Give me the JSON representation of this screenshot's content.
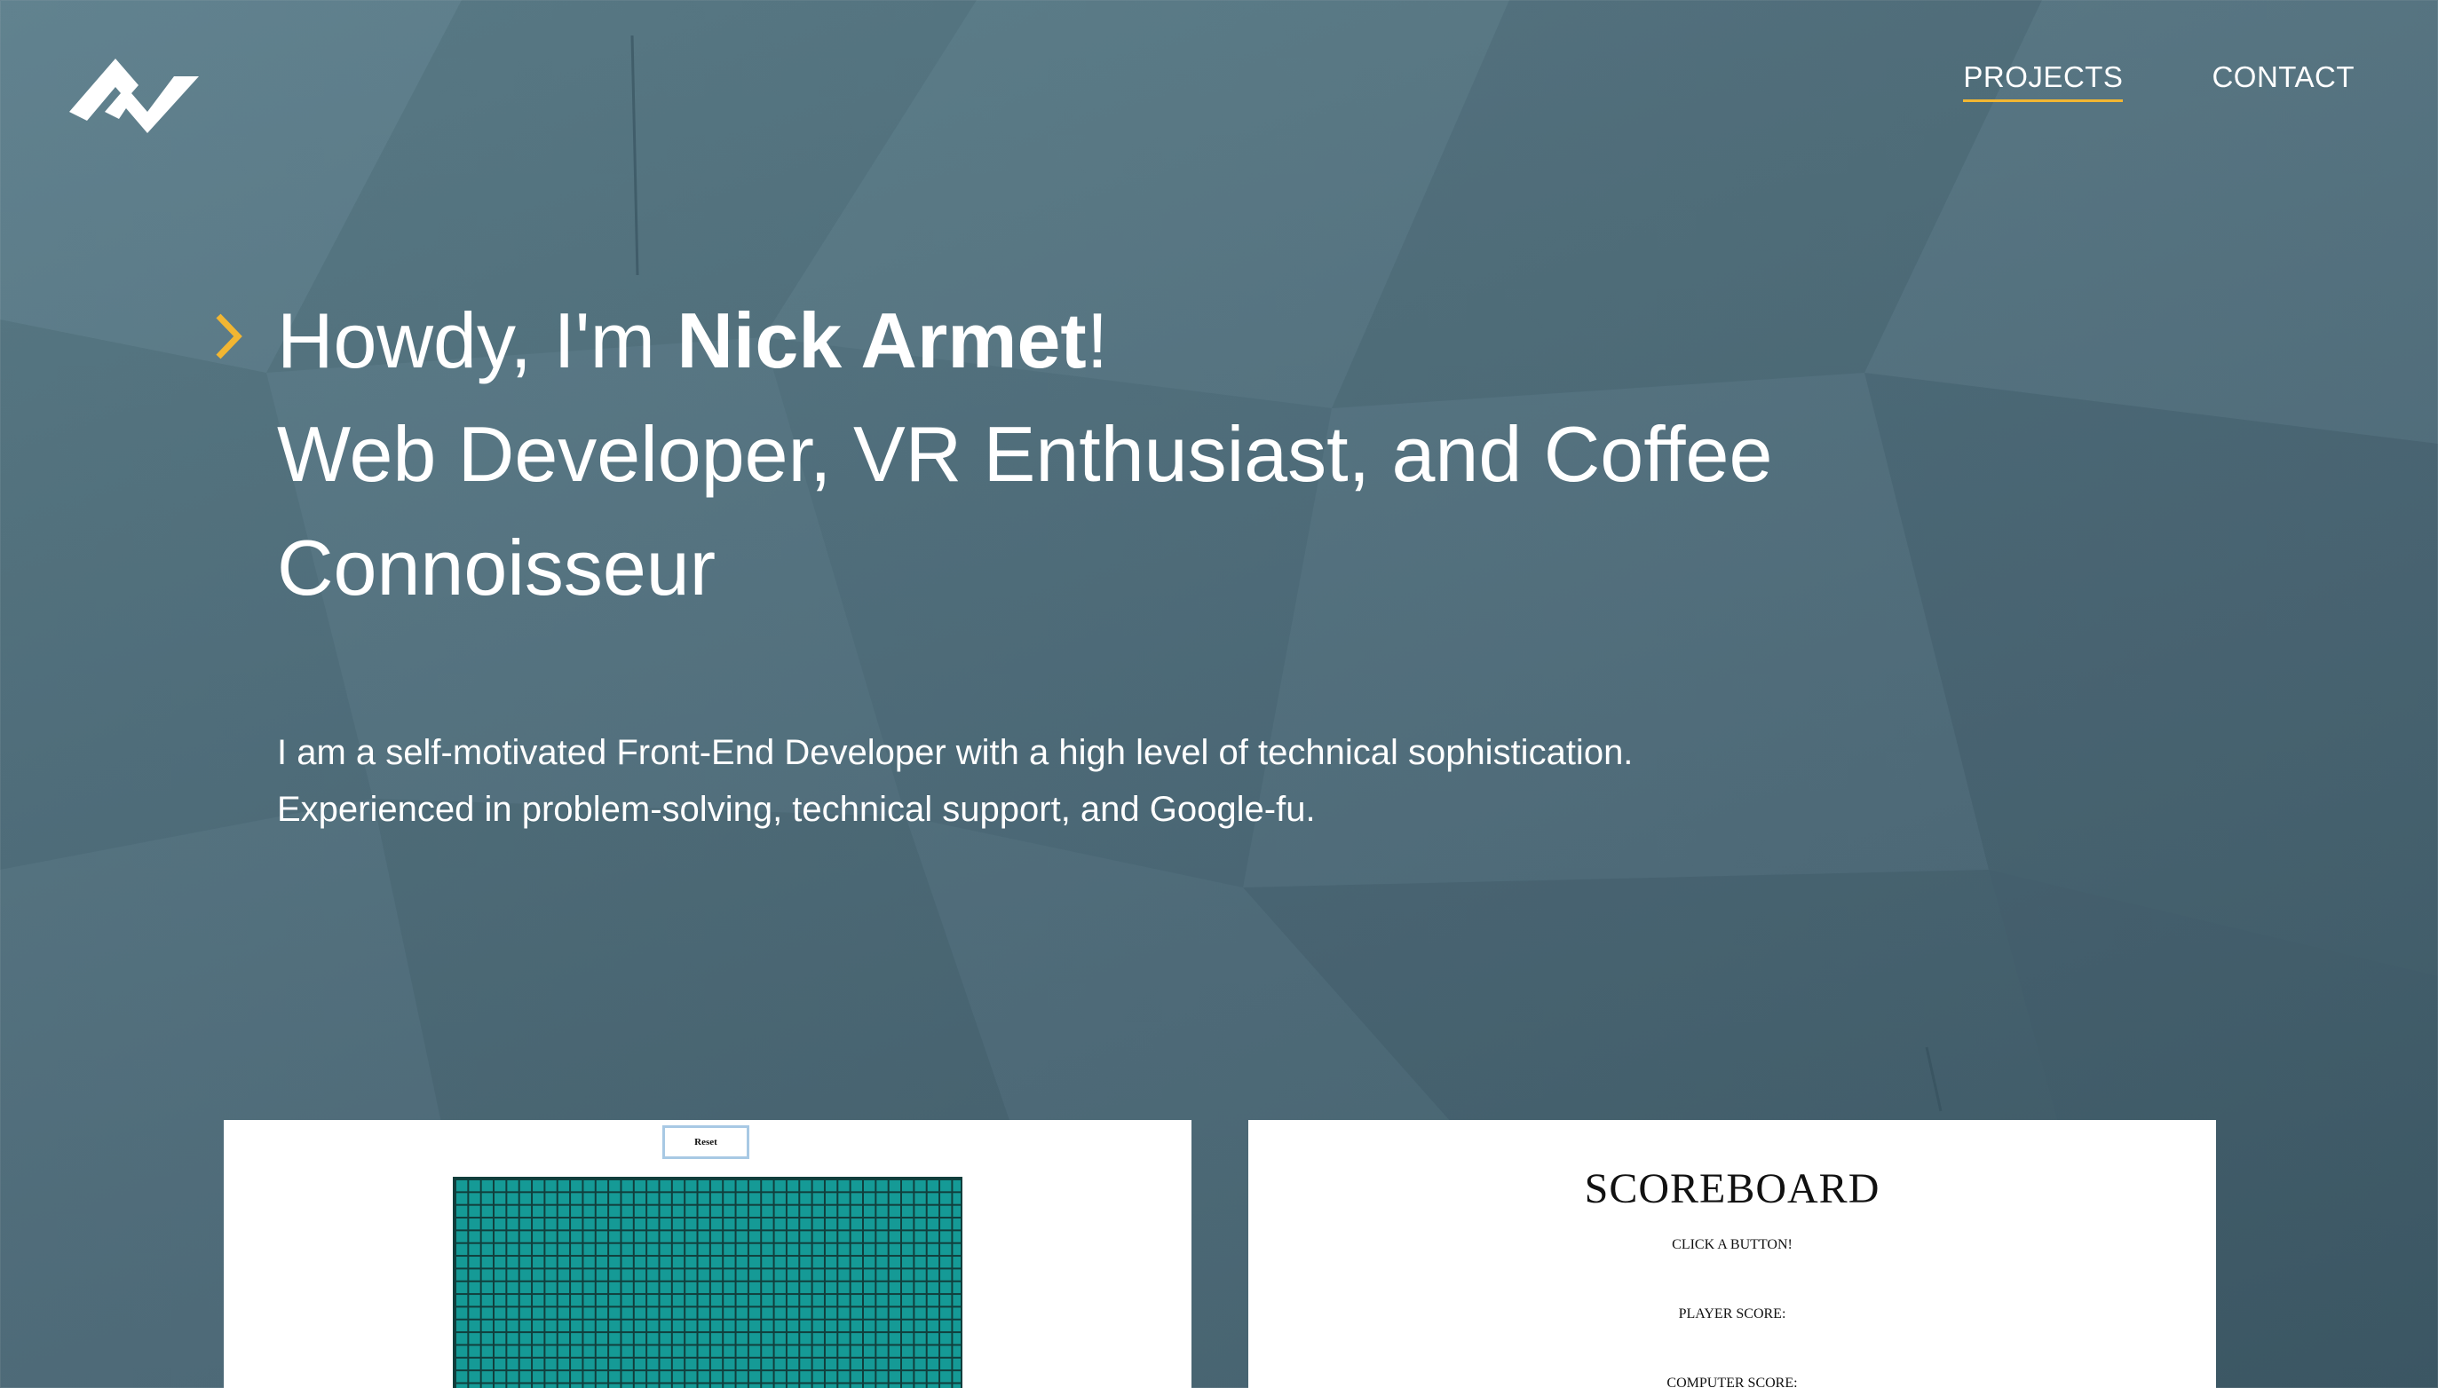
{
  "nav": {
    "items": [
      {
        "label": "PROJECTS",
        "active": true
      },
      {
        "label": "CONTACT",
        "active": false
      }
    ]
  },
  "hero": {
    "greeting_prefix": "Howdy, I'm ",
    "name": "Nick Armet",
    "greeting_suffix": "!",
    "tagline": "Web Developer, VR Enthusiast, and Coffee Connoisseur",
    "intro_line1": "I am a self-motivated Front-End Developer with a high level of technical sophistication.",
    "intro_line2": "Experienced in problem-solving, technical support, and Google-fu."
  },
  "projects": {
    "sketch": {
      "reset_label": "Reset"
    },
    "scoreboard": {
      "title": "SCOREBOARD",
      "message": "CLICK A BUTTON!",
      "player_score_label": "PLAYER SCORE:",
      "computer_score_label": "COMPUTER SCORE:"
    }
  },
  "colors": {
    "accent": "#f2b632",
    "background": "#52717e",
    "grid_fill": "#159a96"
  },
  "icons": [
    "logo-icon",
    "chevron-right-icon"
  ]
}
